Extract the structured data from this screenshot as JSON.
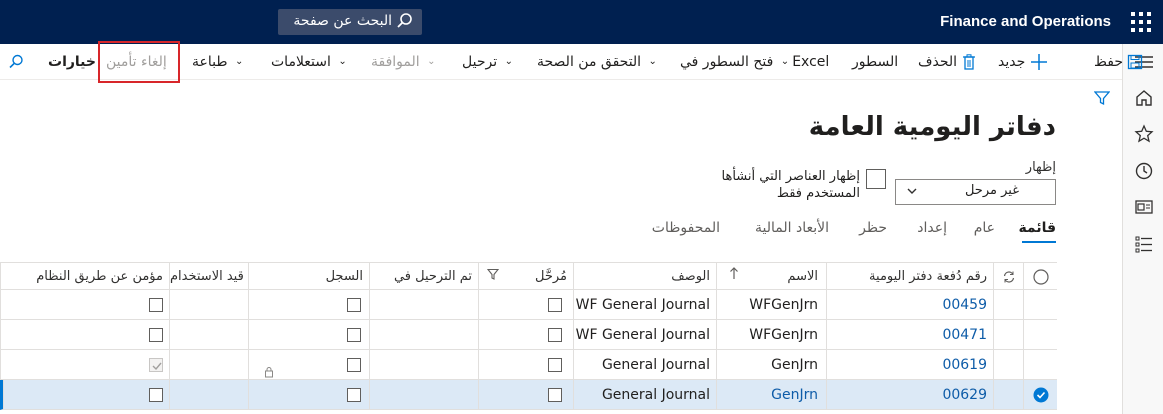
{
  "app": {
    "brand": "Finance and Operations",
    "search_label": "البحث عن صفحة"
  },
  "actions": {
    "save": "حفظ",
    "new": "جديد",
    "delete": "الحذف",
    "lines": "السطور",
    "open_lines_in": "فتح السطور في",
    "excel": "Excel",
    "validate": "التحقق من الصحة",
    "post": "ترحيل",
    "approval": "الموافقة",
    "inquiries": "استعلامات",
    "print": "طباعة",
    "unsecure": "إلغاء تأمين",
    "options": "خيارات"
  },
  "page": {
    "title": "دفاتر اليومية العامة",
    "show_label": "إظهار",
    "show_value": "غير مرحل",
    "user_only_label": "إظهار العناصر التي أنشأها المستخدم فقط"
  },
  "tabs": [
    "قائمة",
    "عام",
    "إعداد",
    "حظر",
    "الأبعاد المالية",
    "المحفوظات"
  ],
  "grid": {
    "headers": {
      "batch": "رقم دُفعة دفتر اليومية",
      "name": "الاسم",
      "description": "الوصف",
      "staged": "مُرحَّل",
      "posted_in": "تم الترحيل في",
      "log": "السجل",
      "in_use": "قيد الاستخدام",
      "system_secured": "مؤمن عن طريق النظام"
    },
    "rows": [
      {
        "batch": "00459",
        "name": "WFGenJrn",
        "description": "WF General Journal",
        "in_use_locked": false,
        "system_checked": false,
        "selected": false
      },
      {
        "batch": "00471",
        "name": "WFGenJrn",
        "description": "WF General Journal",
        "in_use_locked": false,
        "system_checked": false,
        "selected": false
      },
      {
        "batch": "00619",
        "name": "GenJrn",
        "description": "General Journal",
        "in_use_locked": true,
        "system_checked": true,
        "selected": false
      },
      {
        "batch": "00629",
        "name": "GenJrn",
        "description": "General Journal",
        "in_use_locked": false,
        "system_checked": false,
        "selected": true
      }
    ]
  },
  "colors": {
    "topbar": "#002050",
    "accent": "#0078d4",
    "selected_row": "#dce9f6",
    "highlight_box": "#d8262a"
  }
}
